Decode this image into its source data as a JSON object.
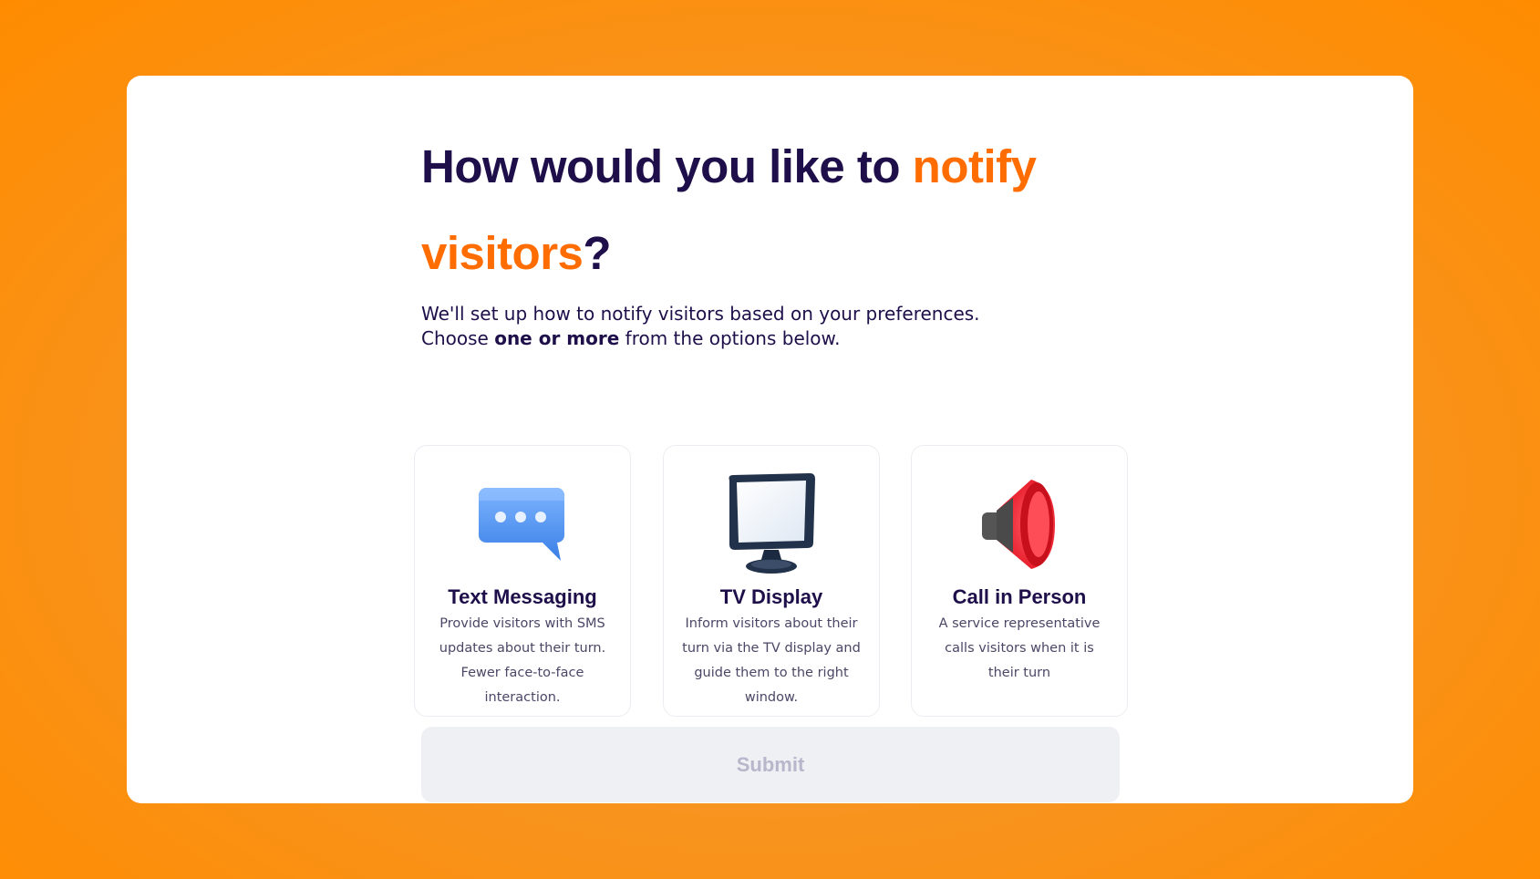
{
  "header": {
    "title_part1": "How would you like to ",
    "title_highlight1": "notify visitors",
    "title_part2": "?",
    "subtitle_line1": "We'll set up how to notify visitors based on your preferences.",
    "subtitle_line2_pre": "Choose ",
    "subtitle_line2_bold": "one or more",
    "subtitle_line2_post": " from the options below."
  },
  "options": [
    {
      "icon": "speech-bubble-icon",
      "title": "Text Messaging",
      "description": "Provide visitors with SMS updates about their turn. Fewer face-to-face interaction."
    },
    {
      "icon": "monitor-icon",
      "title": "TV Display",
      "description": "Inform visitors about their turn via the TV display and guide them to the right window."
    },
    {
      "icon": "megaphone-icon",
      "title": "Call in Person",
      "description": "A service representative calls visitors when it is their turn"
    }
  ],
  "submit": {
    "label": "Submit",
    "disabled": true
  },
  "colors": {
    "background": "#ff8c00",
    "accent": "#ff6d00",
    "text": "#1e0f4a",
    "button_bg": "#eff0f4",
    "button_text": "#b7b6cb"
  }
}
